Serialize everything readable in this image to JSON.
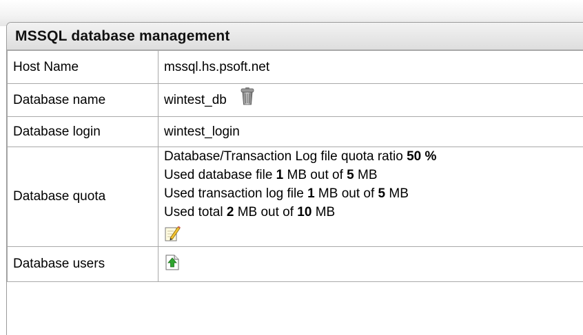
{
  "panel": {
    "title": "MSSQL database management"
  },
  "rows": {
    "host": {
      "label": "Host Name",
      "value": "mssql.hs.psoft.net"
    },
    "dbname": {
      "label": "Database name",
      "value": "wintest_db",
      "icon": "trash-icon"
    },
    "login": {
      "label": "Database login",
      "value": "wintest_login"
    },
    "quota": {
      "label": "Database quota",
      "ratio_text": "Database/Transaction Log file quota ratio",
      "ratio_value": "50",
      "ratio_unit": "%",
      "db_file": {
        "prefix": "Used database file",
        "used": "1",
        "mid": "MB out of",
        "total": "5",
        "unit": "MB"
      },
      "log_file": {
        "prefix": "Used transaction log file",
        "used": "1",
        "mid": "MB out of",
        "total": "5",
        "unit": "MB"
      },
      "total": {
        "prefix": "Used total",
        "used": "2",
        "mid": "MB out of",
        "total": "10",
        "unit": "MB"
      },
      "icon": "edit-icon"
    },
    "users": {
      "label": "Database users",
      "icon": "add-user-icon"
    }
  }
}
